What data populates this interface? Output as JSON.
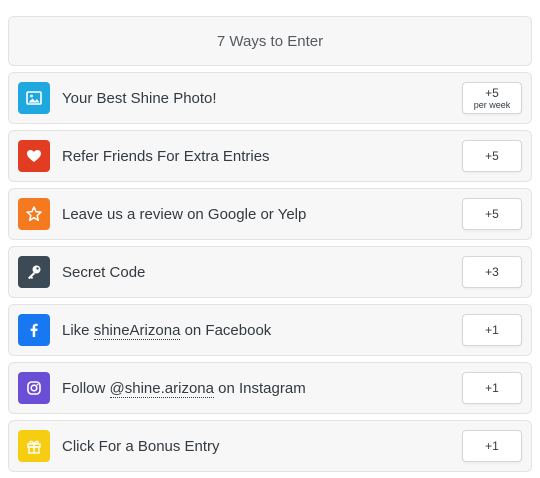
{
  "header": {
    "title": "7 Ways to Enter"
  },
  "entries": [
    {
      "icon": "image-icon",
      "color": "#1fa8e0",
      "label": "Your Best Shine Photo!",
      "points": "+5",
      "points_sub": "per week"
    },
    {
      "icon": "heart-icon",
      "color": "#e23d22",
      "label": "Refer Friends For Extra Entries",
      "points": "+5"
    },
    {
      "icon": "star-icon",
      "color": "#f57a1f",
      "label": "Leave us a review on Google or Yelp",
      "points": "+5"
    },
    {
      "icon": "key-icon",
      "color": "#3b4a54",
      "label": "Secret Code",
      "points": "+3"
    },
    {
      "icon": "facebook-icon",
      "color": "#1778f2",
      "label_pre": "Like ",
      "label_link": "shineArizona",
      "label_post": " on Facebook",
      "points": "+1"
    },
    {
      "icon": "instagram-icon",
      "color": "#6a4fd6",
      "label_pre": "Follow ",
      "label_link": "@shine.arizona",
      "label_post": " on Instagram",
      "points": "+1"
    },
    {
      "icon": "gift-icon",
      "color": "#f7cd12",
      "label": "Click For a Bonus Entry",
      "points": "+1"
    }
  ]
}
